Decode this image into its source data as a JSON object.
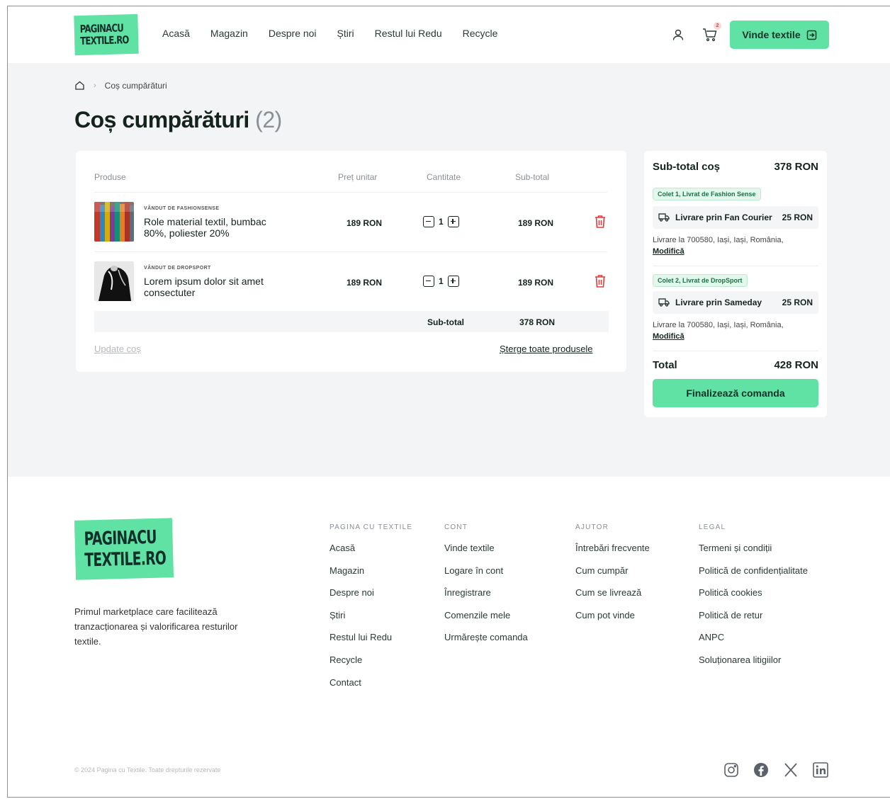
{
  "header": {
    "logo_line1": "PAGINACU",
    "logo_line2": "TEXTILE.RO",
    "nav": [
      "Acasă",
      "Magazin",
      "Despre noi",
      "Știri",
      "Restul lui Redu",
      "Recycle"
    ],
    "cart_count": "2",
    "sell_button": "Vinde textile"
  },
  "breadcrumb": {
    "current": "Coș cumpărături"
  },
  "page": {
    "title": "Coș cumpărături",
    "count": "(2)"
  },
  "cart": {
    "headers": {
      "product": "Produse",
      "unit_price": "Preț unitar",
      "quantity": "Cantitate",
      "subtotal": "Sub-total"
    },
    "items": [
      {
        "seller": "VÂNDUT DE FASHIONSENSE",
        "name": "Role material textil, bumbac 80%, poliester 20%",
        "price": "189 RON",
        "qty": "1",
        "subtotal": "189 RON"
      },
      {
        "seller": "VÂNDUT DE DROPSPORT",
        "name": "Lorem ipsum dolor sit amet consectuter",
        "price": "189 RON",
        "qty": "1",
        "subtotal": "189 RON"
      }
    ],
    "subtotal_label": "Sub-total",
    "subtotal_value": "378 RON",
    "update_link": "Update coș",
    "clear_link": "Șterge toate produsele"
  },
  "summary": {
    "title": "Sub-total coș",
    "subtotal": "378 RON",
    "packages": [
      {
        "tag": "Colet 1, Livrat de Fashion Sense",
        "shipping": "Livrare prin Fan Courier",
        "cost": "25 RON",
        "address": "Livrare la 700580, Iași, Iași, România,",
        "modify": "Modifică"
      },
      {
        "tag": "Colet 2, Livrat de DropSport",
        "shipping": "Livrare prin Sameday",
        "cost": "25 RON",
        "address": "Livrare la 700580, Iași, Iași, România,",
        "modify": "Modifică"
      }
    ],
    "total_label": "Total",
    "total_value": "428 RON",
    "checkout": "Finalizează comanda"
  },
  "footer": {
    "logo_line1": "PAGINACU",
    "logo_line2": "TEXTILE.RO",
    "tagline": "Primul marketplace care facilitează tranzacționarea și valorificarea resturilor textile.",
    "columns": [
      {
        "title": "PAGINA CU TEXTILE",
        "links": [
          "Acasă",
          "Magazin",
          "Despre noi",
          "Știri",
          "Restul lui Redu",
          "Recycle",
          "Contact"
        ]
      },
      {
        "title": "CONT",
        "links": [
          "Vinde textile",
          "Logare în cont",
          "Înregistrare",
          "Comenzile mele",
          "Urmărește comanda"
        ]
      },
      {
        "title": "AJUTOR",
        "links": [
          "Întrebări frecvente",
          "Cum cumpăr",
          "Cum se livrează",
          "Cum pot vinde"
        ]
      },
      {
        "title": "LEGAL",
        "links": [
          "Termeni și condiții",
          "Politică de confidențialitate",
          "Politică cookies",
          "Politică de retur",
          "ANPC",
          "Soluționarea litigiilor"
        ]
      }
    ],
    "copyright": "© 2024 Pagina cu Textile. Toate drepturile rezervate",
    "social": [
      "instagram-icon",
      "facebook-icon",
      "x-icon",
      "linkedin-icon"
    ]
  },
  "colors": {
    "accent": "#5fe2a4",
    "danger": "#e03b3b",
    "background": "#f3f4f6"
  }
}
